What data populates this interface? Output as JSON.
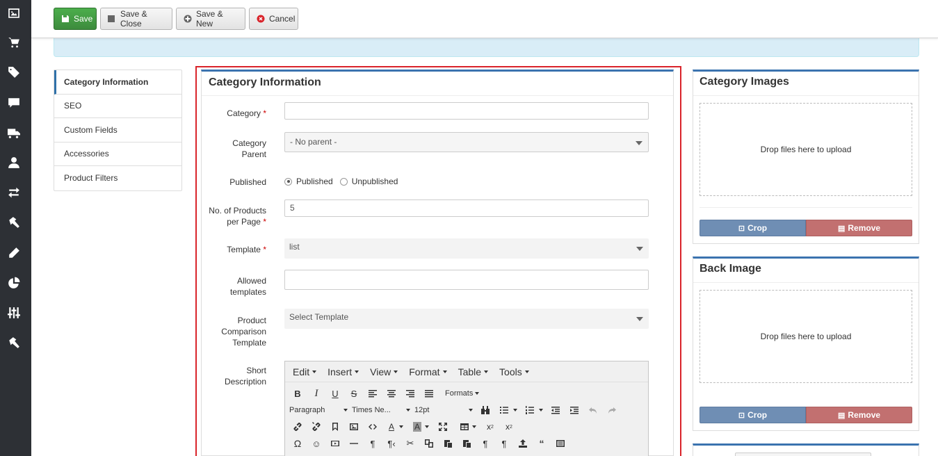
{
  "toolbar": {
    "save": "Save",
    "save_close": "Save & Close",
    "save_new": "Save & New",
    "cancel": "Cancel"
  },
  "nav": {
    "items": [
      {
        "label": "Category Information",
        "active": true
      },
      {
        "label": "SEO"
      },
      {
        "label": "Custom Fields"
      },
      {
        "label": "Accessories"
      },
      {
        "label": "Product Filters"
      }
    ]
  },
  "main": {
    "title": "Category Information",
    "fields": {
      "category_label": "Category",
      "category_value": "",
      "parent_label_1": "Category",
      "parent_label_2": "Parent",
      "parent_value": "- No parent -",
      "published_label": "Published",
      "published_option": "Published",
      "unpublished_option": "Unpublished",
      "products_label_1": "No. of Products",
      "products_label_2": "per Page",
      "products_value": "5",
      "template_label": "Template",
      "template_value": "list",
      "allowed_label_1": "Allowed",
      "allowed_label_2": "templates",
      "allowed_value": "",
      "comparison_label_1": "Product",
      "comparison_label_2": "Comparison",
      "comparison_label_3": "Template",
      "comparison_value": "Select Template",
      "short_label_1": "Short",
      "short_label_2": "Description",
      "required_mark": "*"
    },
    "editor": {
      "menus": [
        "Edit",
        "Insert",
        "View",
        "Format",
        "Table",
        "Tools"
      ],
      "formats": "Formats",
      "block": "Paragraph",
      "font": "Times Ne...",
      "size": "12pt"
    }
  },
  "right": {
    "category_images": {
      "title": "Category Images",
      "dropzone": "Drop files here to upload",
      "crop": "Crop",
      "remove": "Remove"
    },
    "back_image": {
      "title": "Back Image",
      "dropzone": "Drop files here to upload",
      "crop": "Crop",
      "remove": "Remove"
    }
  },
  "colors": {
    "rail": "#2d3035",
    "save_green": "#449d44",
    "panel_accent": "#3b73af",
    "highlight_red": "#d9232a",
    "crop_blue": "#6f8eb4",
    "remove_red": "#c27070",
    "alert_bg": "#d9edf7"
  },
  "icons": [
    "image-icon",
    "cart-icon",
    "tag-icon",
    "comment-icon",
    "truck-icon",
    "user-icon",
    "exchange-icon",
    "hammer-icon",
    "pencil-icon",
    "pie-chart-icon",
    "sliders-icon",
    "hammer-icon"
  ]
}
